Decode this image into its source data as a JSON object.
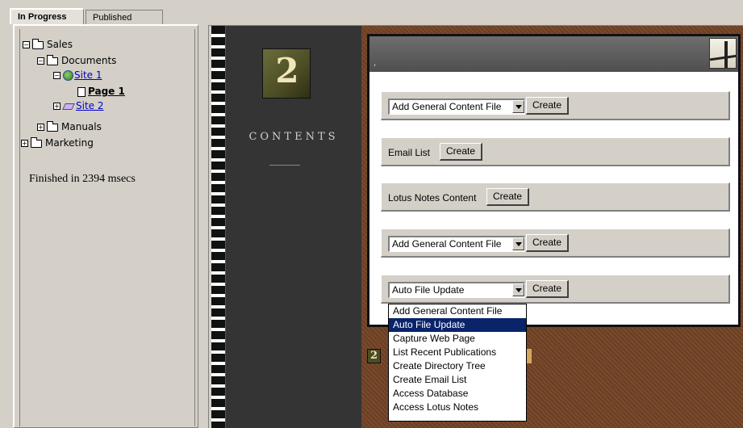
{
  "tabs": {
    "in_progress": "In Progress",
    "published": "Published"
  },
  "tree": {
    "sales": "Sales",
    "documents": "Documents",
    "site1": "Site 1",
    "page1": "Page 1",
    "site2": "Site 2",
    "manuals": "Manuals",
    "marketing": "Marketing",
    "expand_glyph": "⊞",
    "collapse_glyph": "⊟"
  },
  "status": "Finished in 2394 msecs",
  "sidebar": {
    "logo_number": "2",
    "contents_label": "CONTENTS"
  },
  "panel": {
    "header_mark": ","
  },
  "rows": [
    {
      "type": "select",
      "value": "Add General Content File",
      "button": "Create"
    },
    {
      "type": "label",
      "label": "Email List",
      "button": "Create"
    },
    {
      "type": "label",
      "label": "Lotus Notes Content",
      "button": "Create"
    },
    {
      "type": "select",
      "value": "Add General Content File",
      "button": "Create"
    },
    {
      "type": "select",
      "value": "Auto File Update",
      "button": "Create"
    }
  ],
  "dropdown_options": [
    "Add General Content File",
    "Auto File Update",
    "Capture Web Page",
    "List Recent Publications",
    "Create Directory Tree",
    "Create Email List",
    "Access Database",
    "Access Lotus Notes"
  ],
  "dropdown_selected_index": 1,
  "icons": [
    "expand-icon",
    "collapse-icon",
    "folder-icon",
    "globe-site-icon",
    "site-stack-icon",
    "page-icon",
    "dropdown-arrow-icon",
    "bridge-image-icon",
    "logo-2-icon"
  ],
  "colors": {
    "selection": "#0a246a",
    "brown_bg": "#7a4a2c",
    "dark_column": "#343434",
    "link": "#0000cc"
  }
}
